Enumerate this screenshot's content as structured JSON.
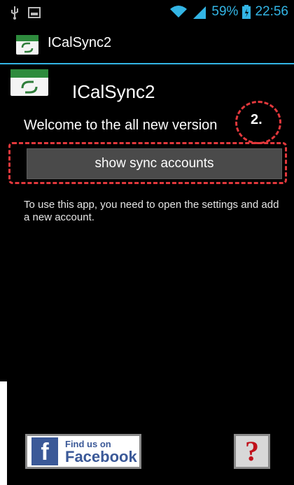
{
  "status_bar": {
    "battery": "59%",
    "time": "22:56",
    "icons": [
      "usb-icon",
      "image-icon",
      "wifi-icon",
      "signal-icon",
      "battery-icon"
    ]
  },
  "action_bar": {
    "title": "ICalSync2",
    "icon": "ical-icon"
  },
  "content": {
    "app_title": "ICalSync2",
    "welcome": "Welcome to the all new version",
    "step_label": "2.",
    "sync_button_label": "show sync accounts",
    "info_text": "To use this app, you need to open the settings and add a new account."
  },
  "bottom": {
    "facebook_find": "Find us on",
    "facebook_name": "Facebook",
    "help_label": "?"
  },
  "colors": {
    "accent": "#33b5e5",
    "annotation": "#e2383c",
    "background": "#000000",
    "button": "#4a4a4a",
    "facebook": "#3b5998"
  }
}
